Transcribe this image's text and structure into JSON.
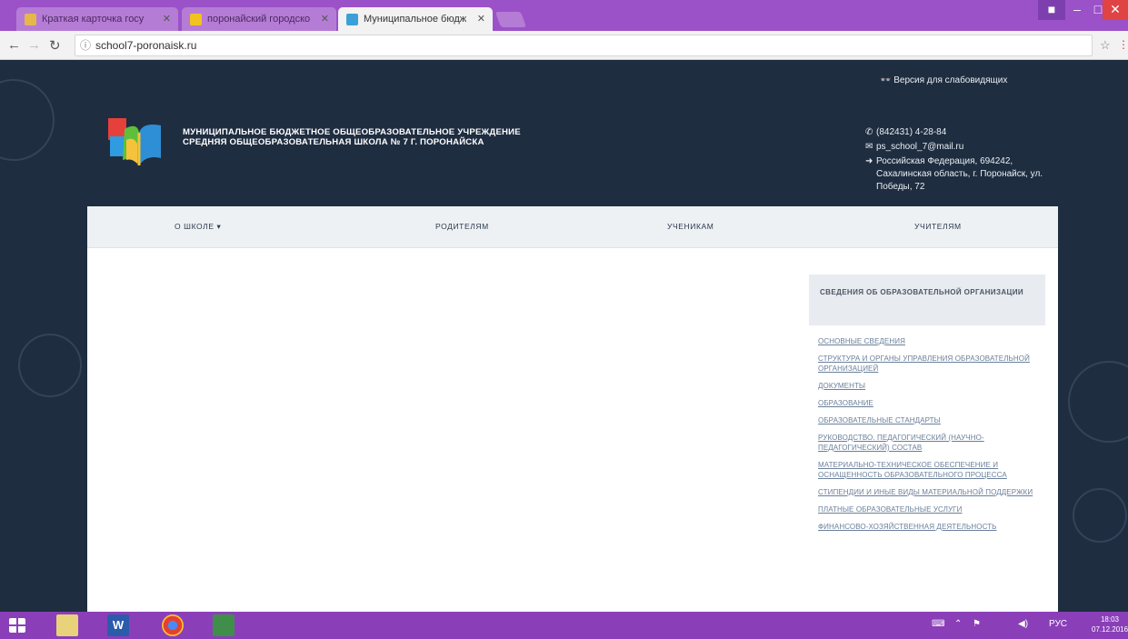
{
  "browser": {
    "tabs": [
      {
        "title": "Краткая карточка госу"
      },
      {
        "title": "поронайский городско"
      },
      {
        "title": "Муниципальное бюдж"
      }
    ],
    "address": "school7-poronaisk.ru"
  },
  "site": {
    "school_name": "Муниципальное бюджетное общеобразовательное учреждение средняя общеобразовательная школа № 7 г. Поронайска",
    "low_vision": "Версия для слабовидящих",
    "phone": "(842431) 4-28-84",
    "email": "ps_school_7@mail.ru",
    "address": "Российская Федерация, 694242, Сахалинская область, г. Поронайск, ул. Победы, 72",
    "menu": [
      "О школе ▾",
      "Родителям",
      "Ученикам",
      "Учителям"
    ],
    "sidebar": {
      "heading": "Сведения об образовательной организации",
      "links": [
        "Основные сведения",
        "Структура и органы управления образовательной организацией",
        "Документы",
        "Образование",
        "Образовательные стандарты",
        "Руководство. Педагогический (научно-педагогический) состав",
        "Материально-техническое обеспечение и оснащенность образовательного процесса",
        "Стипендии и иные виды материальной поддержки",
        "Платные образовательные услуги",
        "Финансово-хозяйственная деятельность"
      ]
    }
  },
  "taskbar": {
    "lang": "РУС",
    "time": "18:03",
    "date": "07.12.2016"
  },
  "colors": {
    "tabbar": "#9b52c8",
    "site_bg": "#1f2d40",
    "taskbar": "#8a3fb8"
  }
}
